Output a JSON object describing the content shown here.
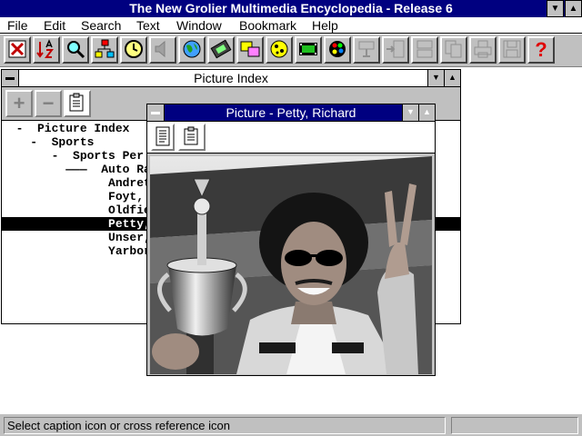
{
  "app": {
    "title": "The New Grolier Multimedia Encyclopedia - Release 6"
  },
  "menu": {
    "items": [
      {
        "label": "File"
      },
      {
        "label": "Edit"
      },
      {
        "label": "Search"
      },
      {
        "label": "Text"
      },
      {
        "label": "Window"
      },
      {
        "label": "Bookmark"
      },
      {
        "label": "Help"
      }
    ]
  },
  "toolbar": {
    "icons": [
      "exit-icon",
      "sort-az-icon",
      "magnifier-icon",
      "hierarchy-icon",
      "timeline-icon",
      "speaker-icon",
      "globe-icon",
      "film-icon",
      "gallery-icon",
      "cheese-icon",
      "video-icon",
      "palette-icon",
      "disabled-icon-1",
      "disabled-icon-2",
      "disabled-icon-3",
      "copy-icon",
      "print-icon",
      "save-icon",
      "help-icon"
    ],
    "help_glyph": "?"
  },
  "index_window": {
    "title": "Picture Index",
    "tree": [
      {
        "text": "  -  Picture Index"
      },
      {
        "text": "    -  Sports"
      },
      {
        "text": "       -  Sports Per"
      },
      {
        "text": "         ———  Auto Rac"
      },
      {
        "text": "               Andret"
      },
      {
        "text": "               Foyt,"
      },
      {
        "text": "               Oldfie"
      },
      {
        "text": "               Petty,"
      },
      {
        "text": "               Unser,"
      },
      {
        "text": "               Yarbor"
      }
    ]
  },
  "picture_window": {
    "title": "Picture - Petty, Richard"
  },
  "status": {
    "text": "Select caption icon or cross reference icon"
  }
}
